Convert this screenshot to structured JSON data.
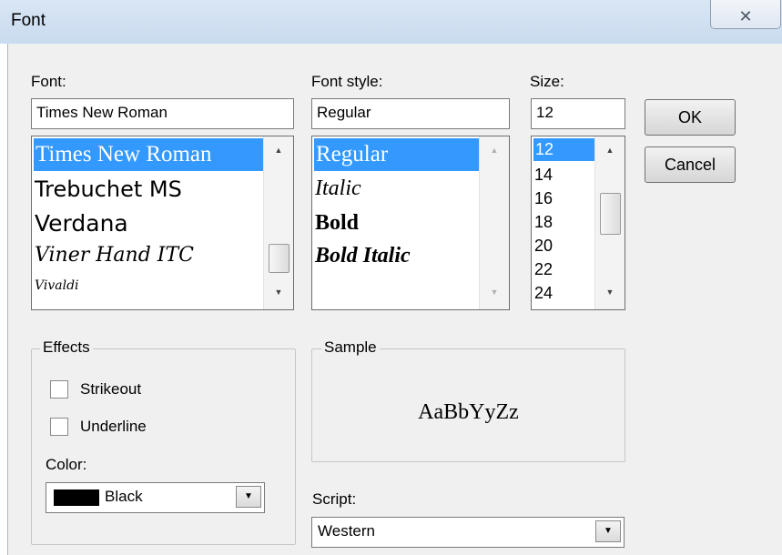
{
  "dialog": {
    "title": "Font",
    "close_symbol": "✕"
  },
  "font": {
    "label": "Font:",
    "value": "Times New Roman",
    "list": [
      "Times New Roman",
      "Trebuchet MS",
      "Verdana",
      "Viner Hand ITC",
      "Vivaldi"
    ]
  },
  "style": {
    "label": "Font style:",
    "value": "Regular",
    "list": [
      "Regular",
      "Italic",
      "Bold",
      "Bold Italic"
    ]
  },
  "size": {
    "label": "Size:",
    "value": "12",
    "list": [
      "12",
      "14",
      "16",
      "18",
      "20",
      "22",
      "24"
    ]
  },
  "buttons": {
    "ok": "OK",
    "cancel": "Cancel"
  },
  "effects": {
    "legend": "Effects",
    "strikeout": "Strikeout",
    "strikeout_checked": false,
    "underline": "Underline",
    "underline_checked": false,
    "color_label": "Color:",
    "color_value": "Black",
    "color_swatch": "#000000"
  },
  "sample": {
    "legend": "Sample",
    "text": "AaBbYyZz"
  },
  "script": {
    "label": "Script:",
    "value": "Western"
  },
  "colors": {
    "selection": "#3399ff",
    "dialog_bg": "#f0f0f0"
  },
  "icons": {
    "scroll_up": "up-arrow-icon",
    "scroll_down": "down-arrow-icon",
    "dropdown": "chevron-down-icon",
    "close": "close-icon"
  }
}
